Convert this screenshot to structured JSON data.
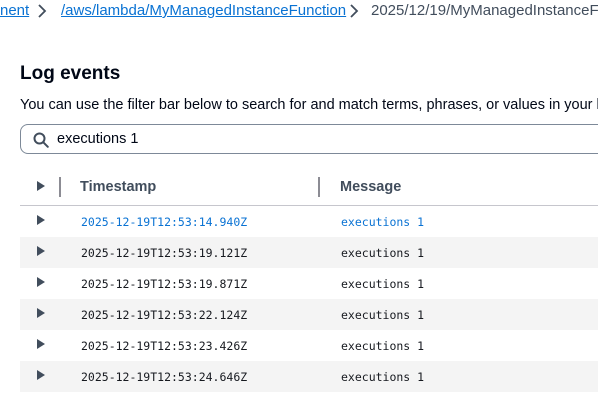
{
  "breadcrumb": {
    "items": [
      {
        "label": "nent",
        "link": true
      },
      {
        "label": "/aws/lambda/MyManagedInstanceFunction",
        "link": true
      },
      {
        "label": "2025/12/19/MyManagedInstanceF",
        "link": false
      }
    ],
    "separator_icon": "chevron-right-icon"
  },
  "section": {
    "title": "Log events",
    "description": "You can use the filter bar below to search for and match terms, phrases, or values in your lo"
  },
  "search": {
    "icon": "search-icon",
    "value": "executions 1"
  },
  "table": {
    "columns": [
      "Timestamp",
      "Message"
    ],
    "expand_icon": "caret-right-icon",
    "rows": [
      {
        "timestamp": "2025-12-19T12:53:14.940Z",
        "message": "executions 1"
      },
      {
        "timestamp": "2025-12-19T12:53:19.121Z",
        "message": "executions 1"
      },
      {
        "timestamp": "2025-12-19T12:53:19.871Z",
        "message": "executions 1"
      },
      {
        "timestamp": "2025-12-19T12:53:22.124Z",
        "message": "executions 1"
      },
      {
        "timestamp": "2025-12-19T12:53:23.426Z",
        "message": "executions 1"
      },
      {
        "timestamp": "2025-12-19T12:53:24.646Z",
        "message": "executions 1"
      }
    ]
  },
  "colors": {
    "link": "#0972d3",
    "alt_row": "#f4f4f4",
    "border": "#7d8998"
  }
}
